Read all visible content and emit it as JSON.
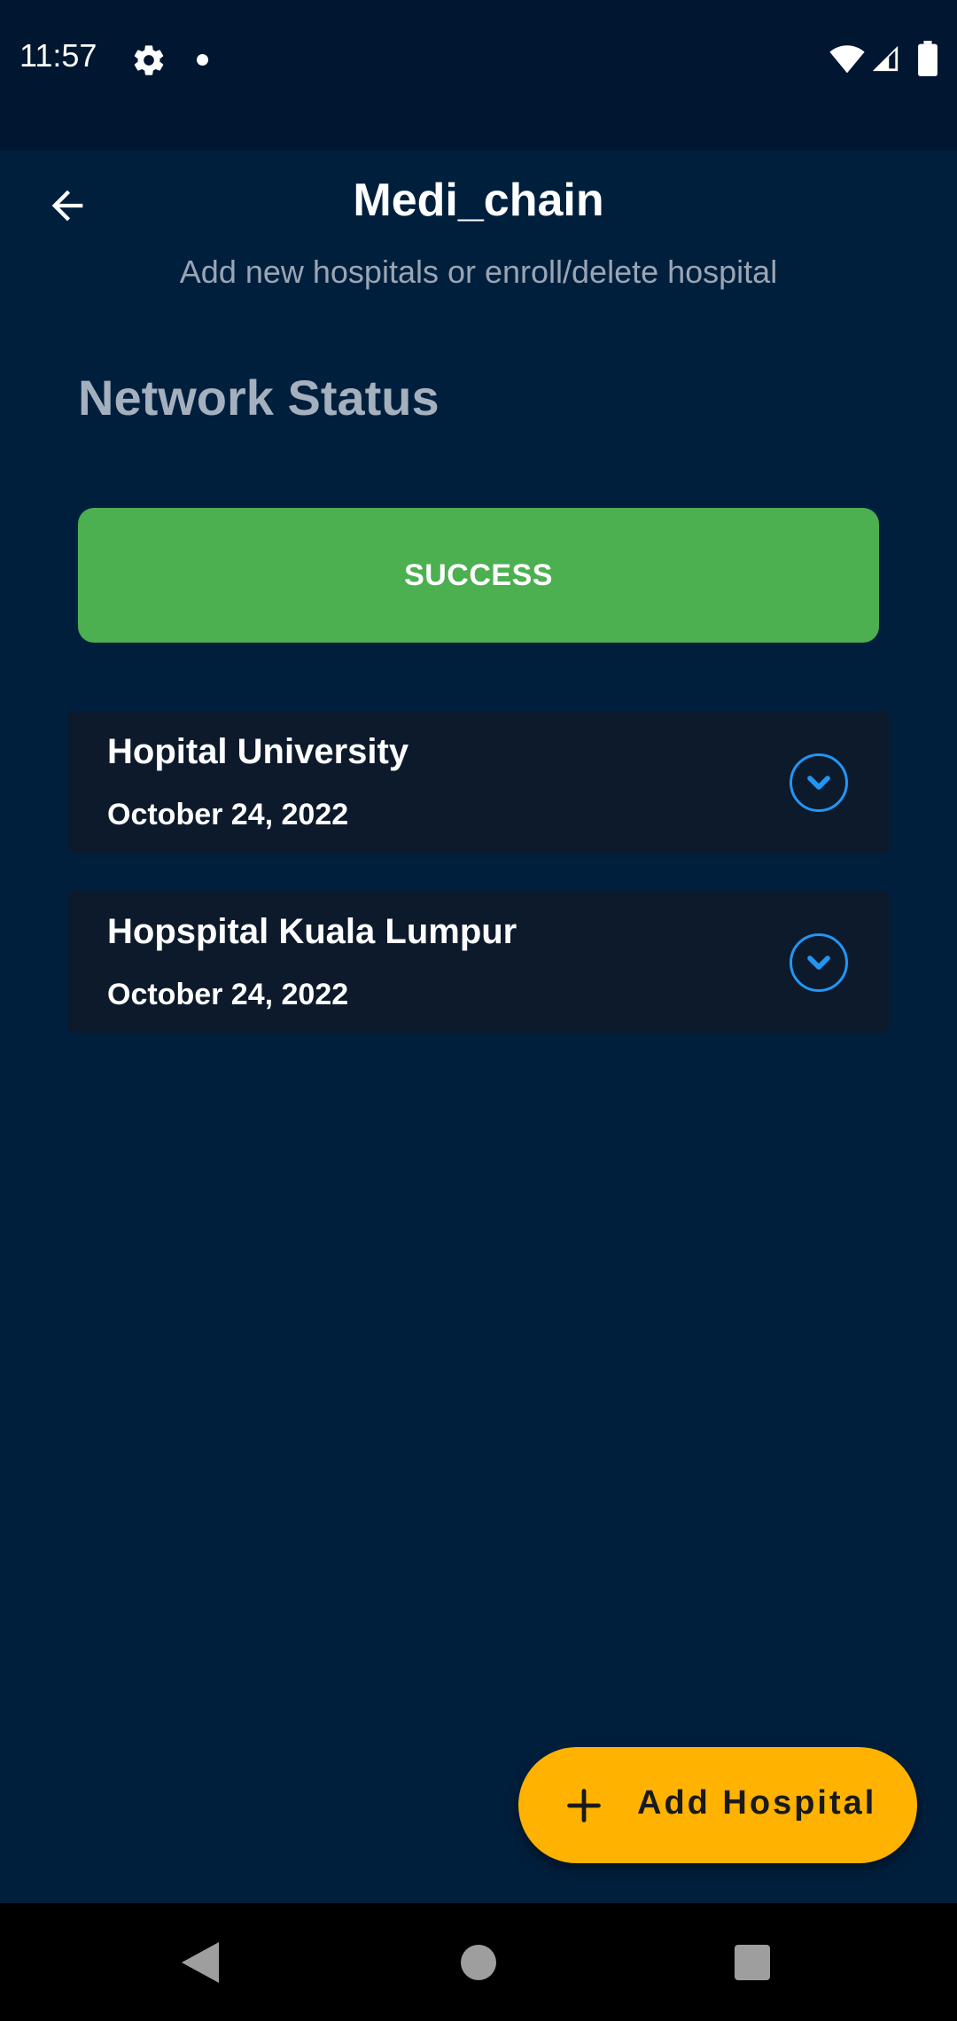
{
  "status_bar": {
    "time": "11:57",
    "icons": [
      "gear-icon",
      "notification-dot-icon",
      "wifi-icon",
      "signal-icon",
      "battery-icon"
    ]
  },
  "app_bar": {
    "title": "Medi_chain",
    "subtitle": "Add new hospitals or enroll/delete hospital",
    "back_icon": "arrow-left-icon"
  },
  "network": {
    "section_title": "Network Status",
    "status_label": "SUCCESS",
    "status_color": "#4caf50"
  },
  "hospitals": [
    {
      "name": "Hopital University",
      "date": "October 24, 2022"
    },
    {
      "name": "Hopspital Kuala Lumpur",
      "date": "October 24, 2022"
    }
  ],
  "fab": {
    "label": "Add Hospital",
    "icon": "plus-icon",
    "color": "#ffb300"
  },
  "colors": {
    "background": "#001f3d",
    "card": "#0d1a2c",
    "accent": "#2196f3"
  }
}
